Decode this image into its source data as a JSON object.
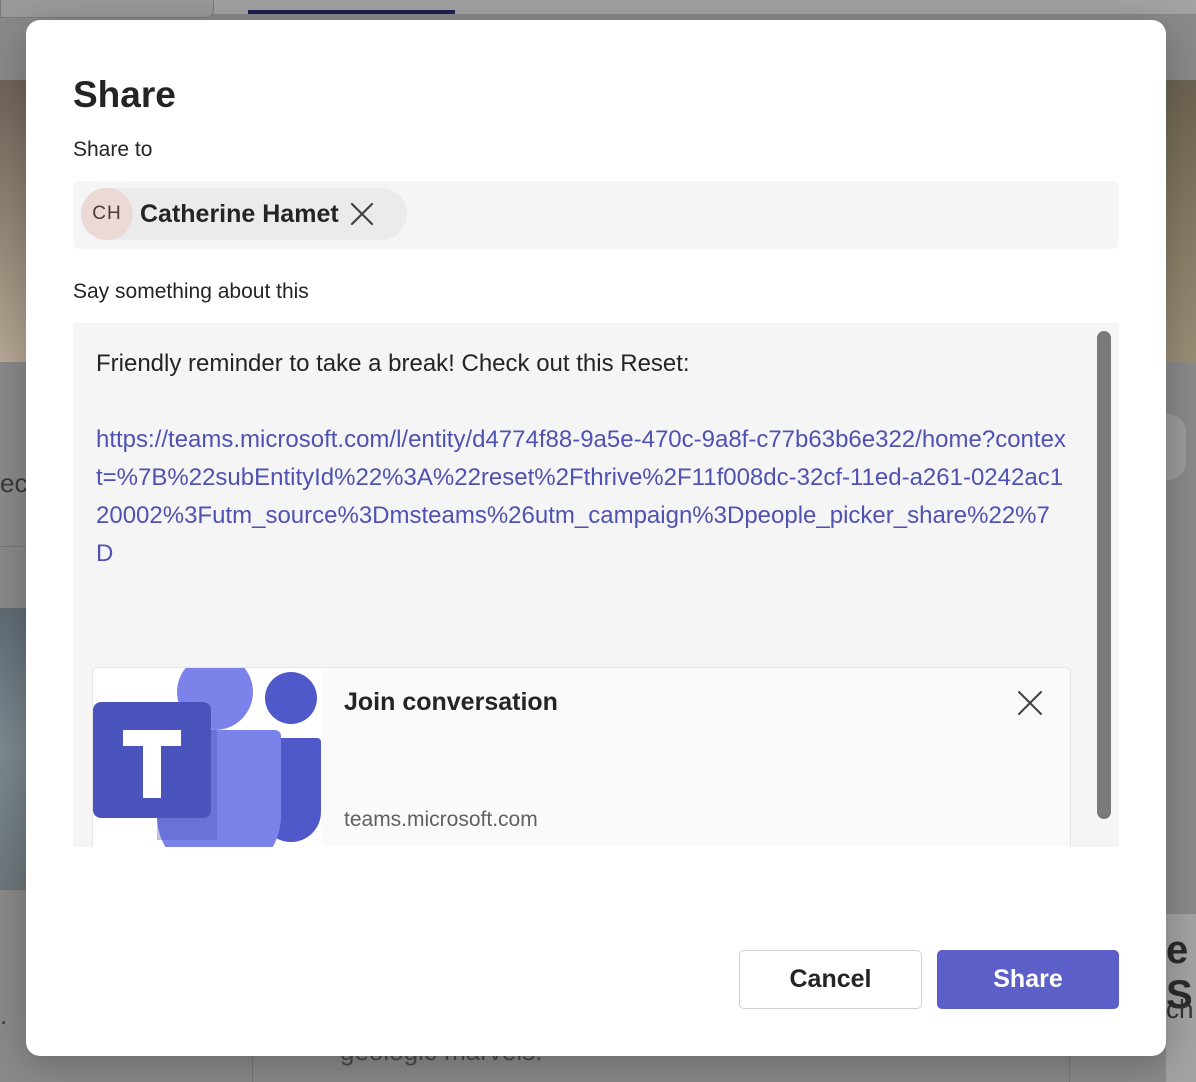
{
  "background": {
    "left_text": "ec",
    "left_dot": ".",
    "bottom_text": "geologic marvels.",
    "right_text_large": "e S",
    "right_text_small": "ch"
  },
  "dialog": {
    "title": "Share",
    "share_to_label": "Share to",
    "recipient": {
      "initials": "CH",
      "name": "Catherine Hamet"
    },
    "message_label": "Say something about this",
    "message": {
      "text": "Friendly reminder to take a break! Check out this Reset:",
      "link": "https://teams.microsoft.com/l/entity/d4774f88-9a5e-470c-9a8f-c77b63b6e322/home?context=%7B%22subEntityId%22%3A%22reset%2Fthrive%2F11f008dc-32cf-11ed-a261-0242ac120002%3Futm_source%3Dmsteams%26utm_campaign%3Dpeople_picker_share%22%7D"
    },
    "link_preview": {
      "title": "Join conversation",
      "domain": "teams.microsoft.com",
      "thumbnail_icon": "microsoft-teams-logo-icon"
    },
    "buttons": {
      "cancel": "Cancel",
      "share": "Share"
    }
  },
  "colors": {
    "accent": "#5b5fc7",
    "link": "#4f52b2",
    "text": "#242424"
  }
}
